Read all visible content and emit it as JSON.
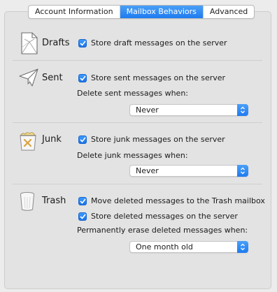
{
  "tabs": [
    {
      "label": "Account Information",
      "active": false
    },
    {
      "label": "Mailbox Behaviors",
      "active": true
    },
    {
      "label": "Advanced",
      "active": false
    }
  ],
  "sections": {
    "drafts": {
      "title": "Drafts",
      "icon": "drafts-document-icon",
      "store_label": "Store draft messages on the server",
      "store_checked": true
    },
    "sent": {
      "title": "Sent",
      "icon": "paper-plane-icon",
      "store_label": "Store sent messages on the server",
      "store_checked": true,
      "delete_label": "Delete sent messages when:",
      "delete_value": "Never"
    },
    "junk": {
      "title": "Junk",
      "icon": "junk-bin-icon",
      "store_label": "Store junk messages on the server",
      "store_checked": true,
      "delete_label": "Delete junk messages when:",
      "delete_value": "Never"
    },
    "trash": {
      "title": "Trash",
      "icon": "trash-can-icon",
      "move_label": "Move deleted messages to the Trash mailbox",
      "move_checked": true,
      "store_label": "Store deleted messages on the server",
      "store_checked": true,
      "erase_label": "Permanently erase deleted messages when:",
      "erase_value": "One month old"
    }
  },
  "colors": {
    "accent": "#1e7bf0",
    "background": "#ececec",
    "panel": "#e3e3e3"
  }
}
